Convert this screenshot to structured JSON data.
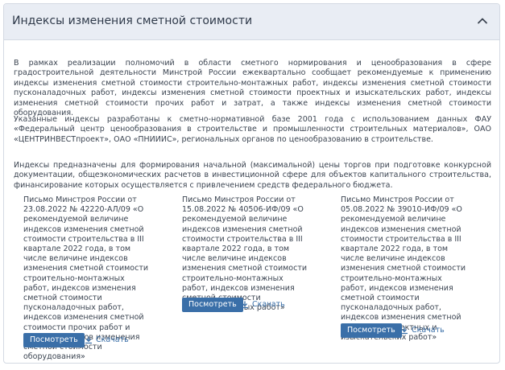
{
  "panel": {
    "title": "Индексы изменения сметной стоимости",
    "paragraphs": [
      "В рамках реализации полномочий в области сметного нормирования и ценообразования в сфере градостроительной деятельности Минстрой России ежеквартально сообщает рекомендуемые к применению индексы изменения сметной стоимости строительно-монтажных работ, индексы изменения сметной стоимости пусконаладочных работ, индексы изменения сметной стоимости проектных и изыскательских работ, индексы изменения сметной стоимости прочих работ и затрат, а также индексы изменения сметной стоимости оборудования.",
      "Указанные индексы разработаны к сметно-нормативной базе 2001 года с использованием данных ФАУ «Федеральный центр ценообразования в строительстве и промышленности строительных материалов», ОАО «ЦЕНТРИНВЕСТпроект», ОАО «ПНИИИС», региональных органов по ценообразованию в строительстве.",
      "Индексы предназначены для формирования начальной (максимальной) цены торгов при подготовке конкурсной документации, общеэкономических расчетов в инвестиционной сфере для объектов капитального строительства, финансирование которых осуществляется с привлечением средств федерального бюджета."
    ],
    "documents": [
      {
        "text": "Письмо Минстроя России от 23.08.2022 № 42220-АЛ/09 «О рекомендуемой величине индексов изменения сметной стоимости строительства в III квартале 2022 года, в том числе величине индексов изменения сметной стоимости строительно-монтажных работ, индексов изменения сметной стоимости пусконаладочных работ, индексов изменения сметной стоимости прочих работ и затрат, индексов изменения сметной стоимости оборудования»",
        "view_label": "Посмотреть",
        "download_label": "Скачать"
      },
      {
        "text": "Письмо Минстроя России от 15.08.2022 № 40506-ИФ/09 «О рекомендуемой величине индексов изменения сметной стоимости строительства в III квартале 2022 года, в том числе величине индексов изменения сметной стоимости строительно-монтажных работ, индексов изменения сметной стоимости пусконаладочных работ»",
        "view_label": "Посмотреть",
        "download_label": "Скачать"
      },
      {
        "text": "Письмо Минстроя России от 05.08.2022 № 39010-ИФ/09 «О рекомендуемой величине индексов изменения сметной стоимости строительства в III квартале 2022 года, в том числе величине индексов изменения сметной стоимости строительно-монтажных работ, индексов изменения сметной стоимости пусконаладочных работ, индексов изменения сметной стоимости проектных и изыскательских работ»",
        "view_label": "Посмотреть",
        "download_label": "Скачать"
      }
    ]
  },
  "icons": {
    "collapse": "chevron-up-icon",
    "download": "download-icon"
  },
  "colors": {
    "header_bg": "#e9edf4",
    "button_bg": "#3a6fa8",
    "link": "#3a6fa8",
    "text": "#3b4451"
  }
}
